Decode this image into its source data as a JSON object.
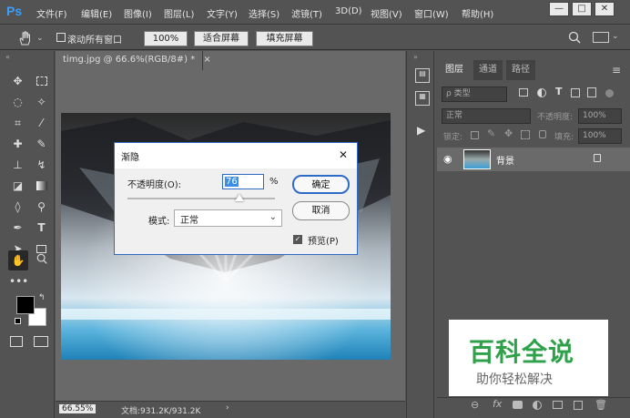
{
  "menubar": {
    "logo": "Ps",
    "items": [
      "文件(F)",
      "编辑(E)",
      "图像(I)",
      "图层(L)",
      "文字(Y)",
      "选择(S)",
      "滤镜(T)",
      "3D(D)",
      "视图(V)",
      "窗口(W)",
      "帮助(H)"
    ],
    "window_controls": {
      "minimize": "—",
      "maximize": "□",
      "close": "✕"
    }
  },
  "options_bar": {
    "scroll_all_label": "滚动所有窗口",
    "zoom_100": "100%",
    "fit_screen": "适合屏幕",
    "fill_screen": "填充屏幕"
  },
  "document": {
    "tab_title": "timg.jpg @ 66.6%(RGB/8#) *",
    "tab_close": "×",
    "zoom_level": "66.55%",
    "doc_info": "文档:931.2K/931.2K",
    "status_arrow": "›"
  },
  "layers_panel": {
    "tabs": [
      "图层",
      "通道",
      "路径"
    ],
    "filter_kind": "ρ 类型",
    "blend_mode": "正常",
    "opacity_label": "不透明度:",
    "opacity_value": "100%",
    "lock_label": "锁定:",
    "fill_label": "填充:",
    "fill_value": "100%",
    "layer_name": "背景"
  },
  "fade_dialog": {
    "title": "渐隐",
    "close": "✕",
    "opacity_label": "不透明度(O):",
    "opacity_value": "76",
    "percent": "%",
    "mode_label": "模式:",
    "mode_value": "正常",
    "ok": "确定",
    "cancel": "取消",
    "preview_label": "预览(P)",
    "preview_checked": true,
    "slider_level": 0.76
  },
  "watermark": {
    "title": "百科全说",
    "subtitle": "助你轻松解决"
  },
  "colors": {
    "ui_bg": "#535353",
    "canvas_bg": "#696969",
    "accent": "#2f6ac7",
    "watermark_green": "#2fa14a"
  }
}
